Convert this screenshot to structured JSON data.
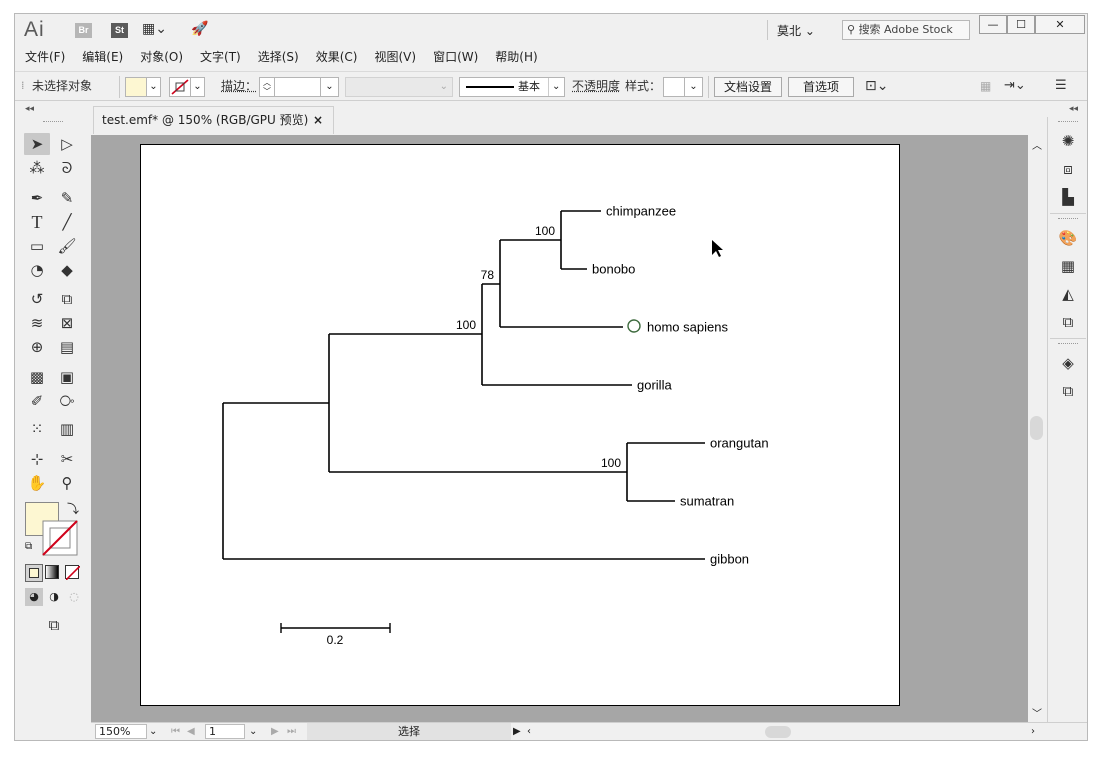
{
  "app": {
    "logo": "Ai",
    "bridge_label": "Br",
    "stock_label": "St",
    "workspace": "莫北",
    "stock_search_placeholder": "搜索 Adobe Stock"
  },
  "menu": [
    "文件(F)",
    "编辑(E)",
    "对象(O)",
    "文字(T)",
    "选择(S)",
    "效果(C)",
    "视图(V)",
    "窗口(W)",
    "帮助(H)"
  ],
  "control": {
    "selection_status": "未选择对象",
    "stroke_label": "描边：",
    "stroke_profile": "基本",
    "opacity_label": "不透明度",
    "style_label": "样式：",
    "doc_setup": "文档设置",
    "preferences": "首选项"
  },
  "document": {
    "tab_title": "test.emf* @ 150% (RGB/GPU 预览)",
    "close_symbol": "×"
  },
  "status": {
    "zoom": "150%",
    "artboard": "1",
    "tool_name": "选择"
  },
  "colors": {
    "fill_swatch": "#fdf7d2",
    "accent_red": "#d0021b"
  },
  "tree": {
    "taxa": [
      "chimpanzee",
      "bonobo",
      "homo sapiens",
      "gorilla",
      "orangutan",
      "sumatran",
      "gibbon"
    ],
    "support": {
      "chimp_bonobo": "100",
      "hominini": "78",
      "homininae": "100",
      "pongo": "100"
    },
    "scale_label": "0.2",
    "highlighted_taxon": "homo sapiens"
  }
}
